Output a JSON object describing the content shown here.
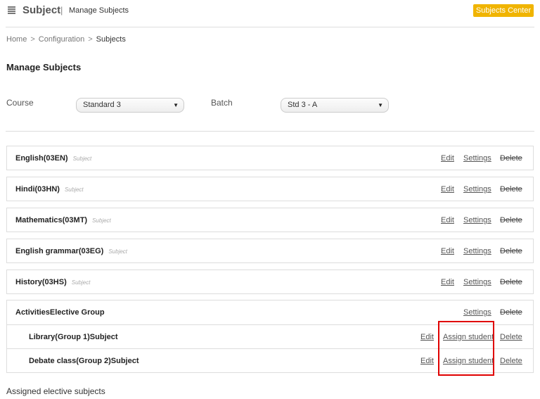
{
  "header": {
    "title": "Subject",
    "separator": "|",
    "subtitle": "Manage Subjects",
    "center_button": "Subjects Center",
    "menu_icon": "menu-icon",
    "accent_color": "#f0b400"
  },
  "breadcrumb": {
    "items": [
      "Home",
      "Configuration",
      "Subjects"
    ],
    "separator": ">"
  },
  "section_title": "Manage Subjects",
  "filters": {
    "course_label": "Course",
    "course_value": "Standard 3",
    "batch_label": "Batch",
    "batch_value": "Std 3 - A"
  },
  "actions": {
    "edit": "Edit",
    "settings": "Settings",
    "delete": "Delete",
    "assign": "Assign student"
  },
  "subjects": [
    {
      "name": "English(03EN)",
      "type": "Subject"
    },
    {
      "name": "Hindi(03HN)",
      "type": "Subject"
    },
    {
      "name": "Mathematics(03MT)",
      "type": "Subject"
    },
    {
      "name": "English grammar(03EG)",
      "type": "Subject"
    },
    {
      "name": "History(03HS)",
      "type": "Subject"
    }
  ],
  "elective_group": {
    "name": "Activities",
    "type": "Elective Group",
    "subjects": [
      {
        "name": "Library(Group 1)",
        "type": "Subject"
      },
      {
        "name": "Debate class(Group 2)",
        "type": "Subject"
      }
    ]
  },
  "footer_text": "Assigned elective subjects",
  "highlight_color": "#e00000"
}
